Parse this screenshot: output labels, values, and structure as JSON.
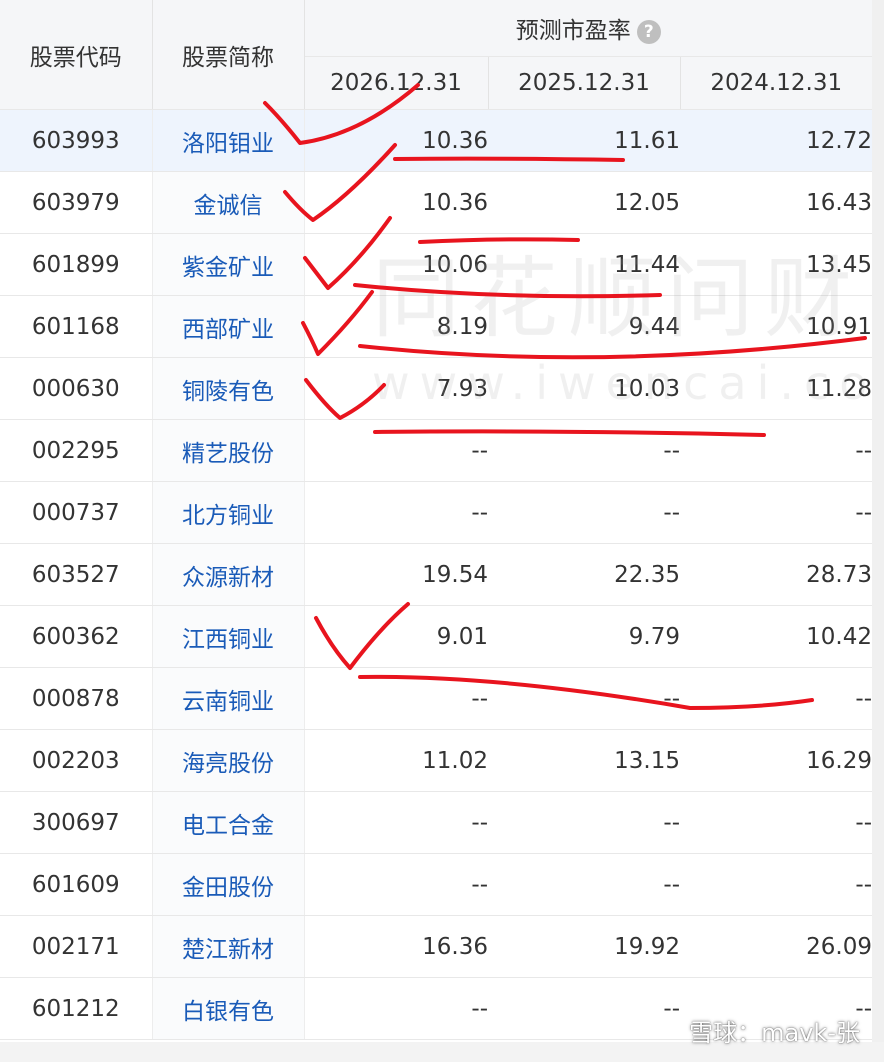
{
  "table": {
    "col_code": "股票代码",
    "col_name": "股票简称",
    "group_title": "预测市盈率",
    "help_glyph": "?",
    "date_cols": [
      "2026.12.31",
      "2025.12.31",
      "2024.12.31"
    ],
    "rows": [
      {
        "code": "603993",
        "name": "洛阳钼业",
        "v2026": "10.36",
        "v2025": "11.61",
        "v2024": "12.72"
      },
      {
        "code": "603979",
        "name": "金诚信",
        "v2026": "10.36",
        "v2025": "12.05",
        "v2024": "16.43"
      },
      {
        "code": "601899",
        "name": "紫金矿业",
        "v2026": "10.06",
        "v2025": "11.44",
        "v2024": "13.45"
      },
      {
        "code": "601168",
        "name": "西部矿业",
        "v2026": "8.19",
        "v2025": "9.44",
        "v2024": "10.91"
      },
      {
        "code": "000630",
        "name": "铜陵有色",
        "v2026": "7.93",
        "v2025": "10.03",
        "v2024": "11.28"
      },
      {
        "code": "002295",
        "name": "精艺股份",
        "v2026": "--",
        "v2025": "--",
        "v2024": "--"
      },
      {
        "code": "000737",
        "name": "北方铜业",
        "v2026": "--",
        "v2025": "--",
        "v2024": "--"
      },
      {
        "code": "603527",
        "name": "众源新材",
        "v2026": "19.54",
        "v2025": "22.35",
        "v2024": "28.73"
      },
      {
        "code": "600362",
        "name": "江西铜业",
        "v2026": "9.01",
        "v2025": "9.79",
        "v2024": "10.42"
      },
      {
        "code": "000878",
        "name": "云南铜业",
        "v2026": "--",
        "v2025": "--",
        "v2024": "--"
      },
      {
        "code": "002203",
        "name": "海亮股份",
        "v2026": "11.02",
        "v2025": "13.15",
        "v2024": "16.29"
      },
      {
        "code": "300697",
        "name": "电工合金",
        "v2026": "--",
        "v2025": "--",
        "v2024": "--"
      },
      {
        "code": "601609",
        "name": "金田股份",
        "v2026": "--",
        "v2025": "--",
        "v2024": "--"
      },
      {
        "code": "002171",
        "name": "楚江新材",
        "v2026": "16.36",
        "v2025": "19.92",
        "v2024": "26.09"
      },
      {
        "code": "601212",
        "name": "白银有色",
        "v2026": "--",
        "v2025": "--",
        "v2024": "--"
      }
    ]
  },
  "watermark": {
    "cn": "同花顺问财",
    "en": "www.iwencai.com",
    "corner": "雪球：mavk-张"
  },
  "colors": {
    "link": "#1a5bb8",
    "header_bg": "#f5f6f8",
    "highlight_row": "#eef4fd",
    "annotation": "#e8141e"
  }
}
